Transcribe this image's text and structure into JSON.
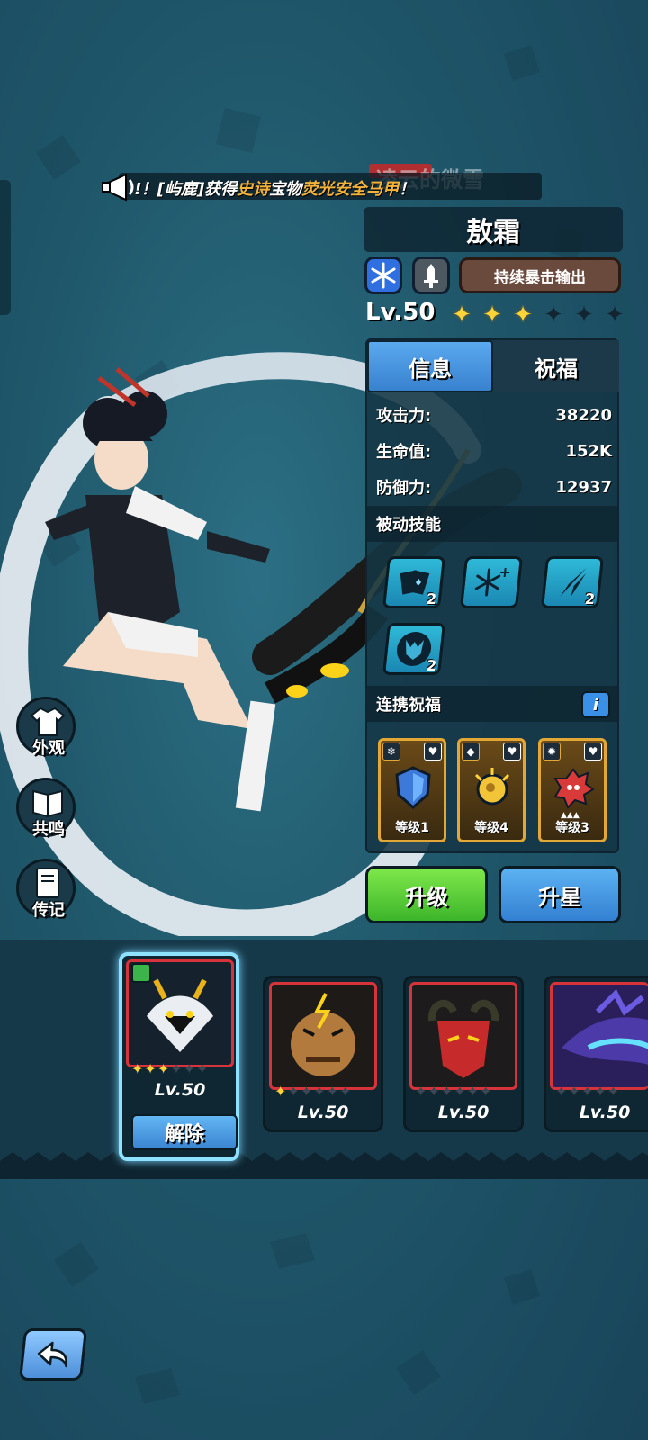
{
  "announcement": {
    "prefix": "ǃ！[",
    "player": "屿鹿",
    "mid1": "]获得",
    "rarity": "史诗",
    "mid2": "宝物",
    "item": "荧光安全马甲",
    "suffix": "！",
    "behind_text": "凌云的微雪"
  },
  "hero": {
    "name": "敖霜",
    "element_icon": "snowflake-icon",
    "class_icon": "sword-icon",
    "role": "持续暴击输出",
    "level": "Lv.50",
    "stars_filled": 3,
    "stars_total": 6
  },
  "tabs": {
    "info": "信息",
    "bless": "祝福"
  },
  "stats": [
    {
      "label": "攻击力:",
      "value": "38220"
    },
    {
      "label": "生命值:",
      "value": "152K"
    },
    {
      "label": "防御力:",
      "value": "12937"
    }
  ],
  "passive": {
    "title": "被动技能",
    "skills": [
      {
        "icon": "card-icon",
        "level": "2"
      },
      {
        "icon": "snowflakes-icon",
        "level": ""
      },
      {
        "icon": "shard-icon",
        "level": "2"
      },
      {
        "icon": "dragon-icon",
        "level": "2"
      }
    ]
  },
  "link_bless": {
    "title": "连携祝福",
    "info_btn": "i",
    "cards": [
      {
        "label": "等级1",
        "icon": "shield-icon"
      },
      {
        "label": "等级4",
        "icon": "coin-icon"
      },
      {
        "label": "等级3",
        "icon": "demon-icon",
        "badge": "▲▲▲"
      }
    ]
  },
  "buttons": {
    "upgrade": "升级",
    "star_up": "升星"
  },
  "side_menu": [
    {
      "label": "外观",
      "icon": "shirt-icon"
    },
    {
      "label": "共鸣",
      "icon": "book-icon"
    },
    {
      "label": "传记",
      "icon": "journal-icon"
    }
  ],
  "roster": [
    {
      "level": "Lv.50",
      "stars_filled": 3,
      "action": "解除",
      "selected": true
    },
    {
      "level": "Lv.50",
      "stars_filled": 1
    },
    {
      "level": "Lv.50",
      "stars_filled": 0
    },
    {
      "level": "Lv.50",
      "stars_filled": 0
    }
  ],
  "colors": {
    "accent_blue": "#3a8fe6",
    "upgrade_green": "#3db52a",
    "star_gold": "#ffd33a",
    "epic_gold": "#f3b23a"
  }
}
